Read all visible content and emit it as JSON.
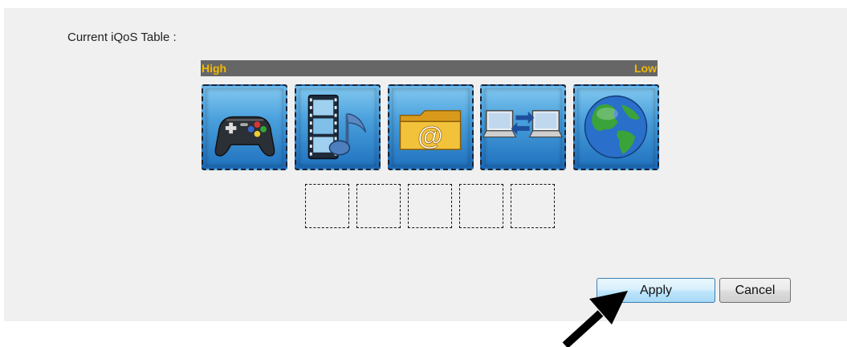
{
  "iqos": {
    "table_label": "Current iQoS Table :",
    "priority_high": "High",
    "priority_low": "Low",
    "slots": [
      {
        "icon": "gamepad-icon"
      },
      {
        "icon": "film-music-icon"
      },
      {
        "icon": "email-folder-icon"
      },
      {
        "icon": "computer-transfer-icon"
      },
      {
        "icon": "globe-icon"
      }
    ],
    "empty_slot_count": 5
  },
  "actions": {
    "apply_label": "Apply",
    "cancel_label": "Cancel"
  },
  "colors": {
    "priority_bar": "#666666",
    "priority_text": "#f2b800",
    "panel_background": "#f0f0f0",
    "icon_tile": "#3e94d6"
  }
}
